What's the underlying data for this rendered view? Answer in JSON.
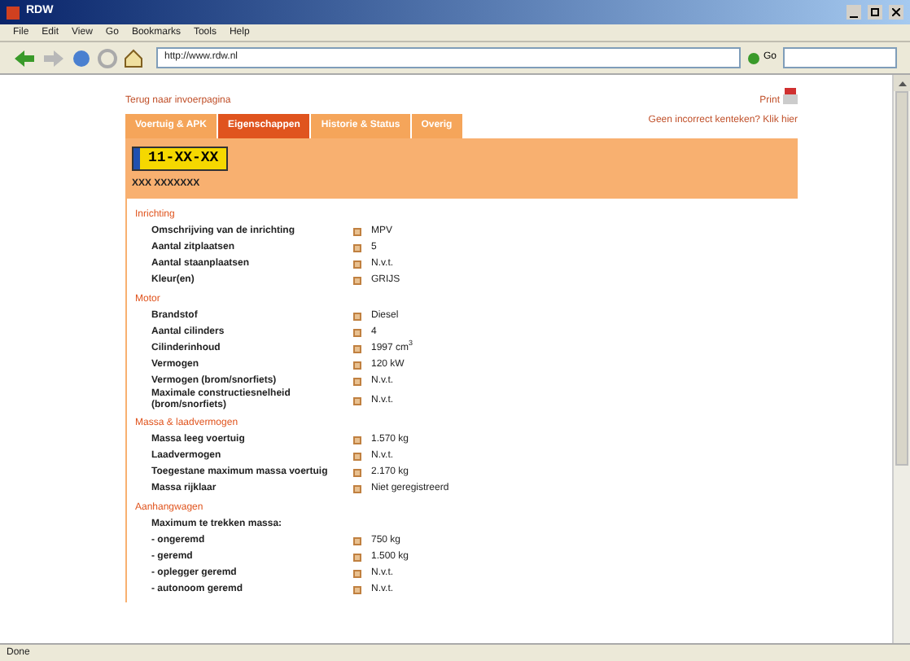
{
  "window": {
    "title": "RDW"
  },
  "menu": [
    "File",
    "Edit",
    "View",
    "Go",
    "Bookmarks",
    "Tools",
    "Help"
  ],
  "address": {
    "value": "http://www.rdw.nl"
  },
  "go_button": "Go",
  "back_link": "Terug naar invoerpagina",
  "print_link": "Print",
  "report_link": "Geen incorrect kenteken? Klik hier",
  "tabs": [
    {
      "label": "Voertuig & APK",
      "selected": false
    },
    {
      "label": "Eigenschappen",
      "selected": true
    },
    {
      "label": "Historie & Status",
      "selected": false
    },
    {
      "label": "Overig",
      "selected": false
    }
  ],
  "plate": "11-XX-XX",
  "vehicle_name": "XXX XXXXXXX",
  "sections": [
    {
      "title": "Inrichting",
      "rows": [
        {
          "label": "Omschrijving van de inrichting",
          "value": "MPV"
        },
        {
          "label": "Aantal zitplaatsen",
          "value": "5"
        },
        {
          "label": "Aantal staanplaatsen",
          "value": "N.v.t."
        },
        {
          "label": "Kleur(en)",
          "value": "GRIJS"
        }
      ]
    },
    {
      "title": "Motor",
      "rows": [
        {
          "label": "Brandstof",
          "value": "Diesel"
        },
        {
          "label": "Aantal cilinders",
          "value": "4"
        },
        {
          "label": "Cilinderinhoud",
          "value": "1997 cm$^{3}$"
        },
        {
          "label": "Vermogen",
          "value": "120 kW"
        },
        {
          "label": "Vermogen (brom/snorfiets)",
          "value": "N.v.t."
        },
        {
          "label": "Maximale constructiesnelheid (brom/snorfiets)",
          "value": "N.v.t."
        }
      ]
    },
    {
      "title": "Massa & laadvermogen",
      "rows": [
        {
          "label": "Massa leeg voertuig",
          "value": "1.570 kg"
        },
        {
          "label": "Laadvermogen",
          "value": "N.v.t."
        },
        {
          "label": "Toegestane maximum massa voertuig",
          "value": "2.170 kg"
        },
        {
          "label": "Massa rijklaar",
          "value": "Niet geregistreerd"
        }
      ]
    },
    {
      "title": "Aanhangwagen",
      "rows": [
        {
          "label": "Maximum te trekken massa:"
        },
        {
          "label": "- ongeremd",
          "value": "750 kg"
        },
        {
          "label": "- geremd",
          "value": "1.500 kg"
        },
        {
          "label": "- oplegger geremd",
          "value": "N.v.t."
        },
        {
          "label": "- autonoom geremd",
          "value": "N.v.t."
        }
      ]
    }
  ],
  "status_bar": "Done"
}
